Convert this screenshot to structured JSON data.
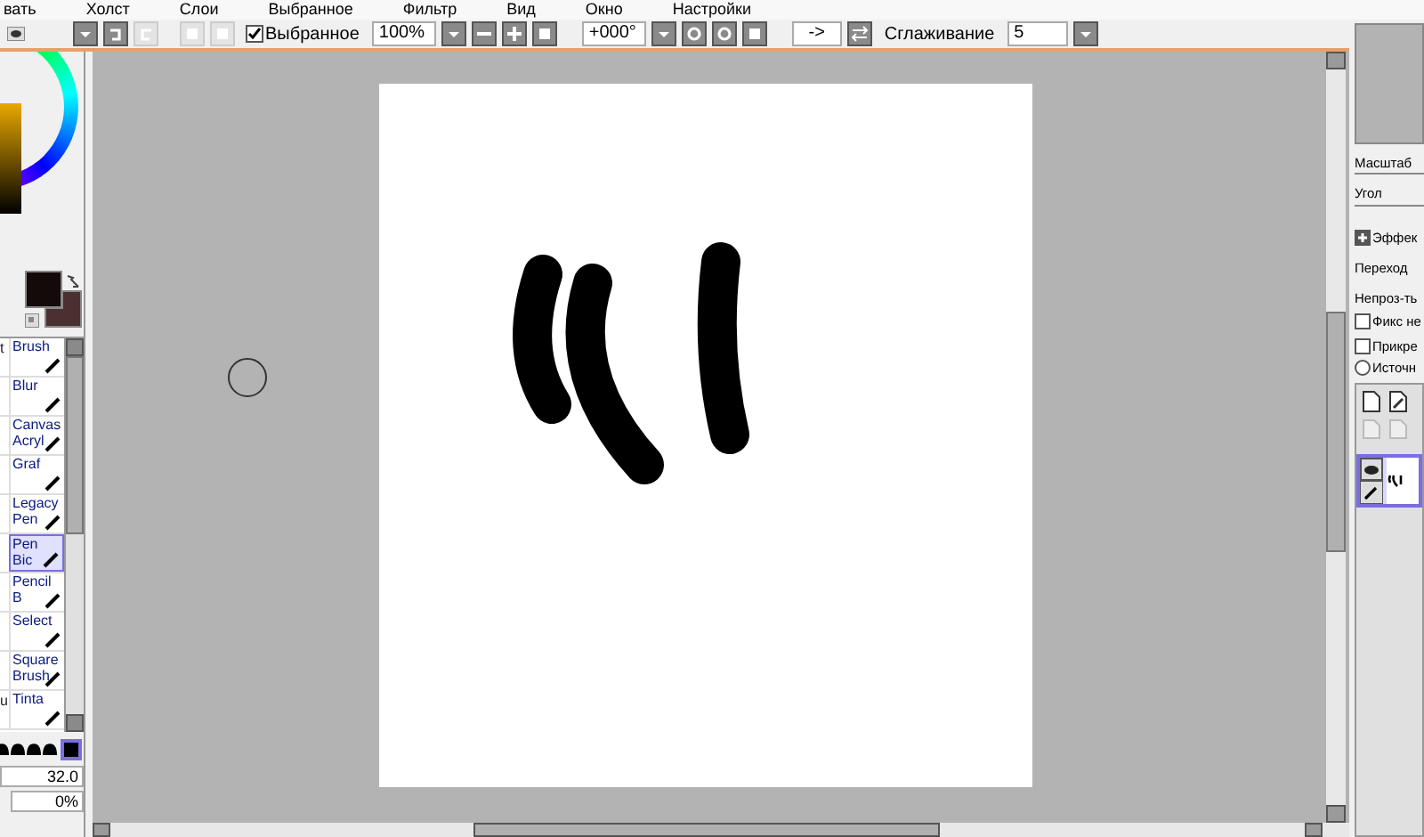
{
  "menu": [
    "вать",
    "Холст",
    "Слои",
    "Выбранное",
    "Фильтр",
    "Вид",
    "Окно",
    "Настройки"
  ],
  "toolbar": {
    "selection_checkbox": {
      "label": "Выбранное",
      "checked": true
    },
    "zoom": "100%",
    "angle": "+000°",
    "flip": "->",
    "smoothing_label": "Сглаживание",
    "smoothing": "5"
  },
  "tools": [
    {
      "fragment": "t",
      "lines": [
        "Brush"
      ],
      "selected": false
    },
    {
      "lines": [
        "Blur"
      ],
      "selected": false
    },
    {
      "lines": [
        "Canvas",
        "Acryl"
      ],
      "selected": false
    },
    {
      "lines": [
        "Graf"
      ],
      "selected": false
    },
    {
      "lines": [
        "Legacy",
        "Pen"
      ],
      "selected": false
    },
    {
      "lines": [
        "Pen",
        "Bic"
      ],
      "selected": true
    },
    {
      "lines": [
        "Pencil",
        "B"
      ],
      "selected": false
    },
    {
      "lines": [
        "Select"
      ],
      "selected": false
    },
    {
      "lines": [
        "Square",
        "Brush"
      ],
      "selected": false
    },
    {
      "fragment": "u",
      "lines": [
        "Tinta"
      ],
      "selected": false
    }
  ],
  "brush_size": "32.0",
  "min_size": "0%",
  "navigator": {
    "labels": [
      "Масштаб",
      "Угол"
    ]
  },
  "layer_panel": {
    "effect": "Эффек",
    "blend": "Переход",
    "opacity": "Непроз-ть",
    "checkboxes": [
      {
        "label": "Фикс не",
        "checked": false
      },
      {
        "label": "Прикре",
        "checked": false
      }
    ],
    "radio": {
      "label": "Источн",
      "selected": false
    },
    "layers": [
      {
        "selected": true,
        "visible": true
      }
    ]
  }
}
